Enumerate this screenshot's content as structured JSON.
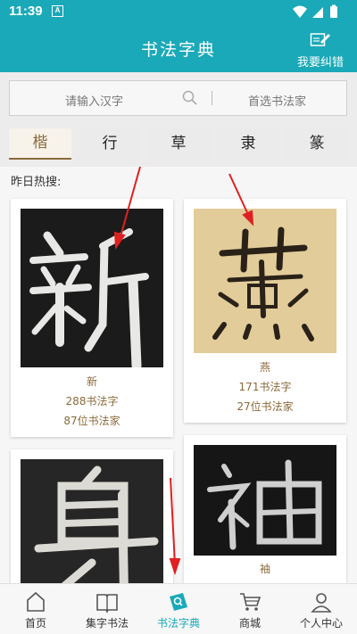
{
  "status": {
    "time": "11:39",
    "notif": "A"
  },
  "header": {
    "title": "书法字典",
    "report": "我要纠错"
  },
  "search": {
    "input_placeholder": "请输入汉字",
    "calligrapher_placeholder": "首选书法家"
  },
  "tabs": [
    "楷",
    "行",
    "草",
    "隶",
    "篆"
  ],
  "hot_label": "昨日热搜:",
  "cards": [
    {
      "char": "新",
      "count": "288书法字",
      "artists": "87位书法家"
    },
    {
      "char": "燕",
      "count": "171书法字",
      "artists": "27位书法家"
    },
    {
      "char": "身"
    },
    {
      "char": "袖"
    }
  ],
  "nav": [
    {
      "label": "首页",
      "icon": "home-icon"
    },
    {
      "label": "集字书法",
      "icon": "book-icon"
    },
    {
      "label": "书法字典",
      "icon": "dictionary-icon"
    },
    {
      "label": "商城",
      "icon": "cart-icon"
    },
    {
      "label": "个人中心",
      "icon": "person-icon"
    }
  ],
  "colors": {
    "accent": "#1aa9b8",
    "brown": "#8b6a3a",
    "annotation": "#e02020"
  }
}
